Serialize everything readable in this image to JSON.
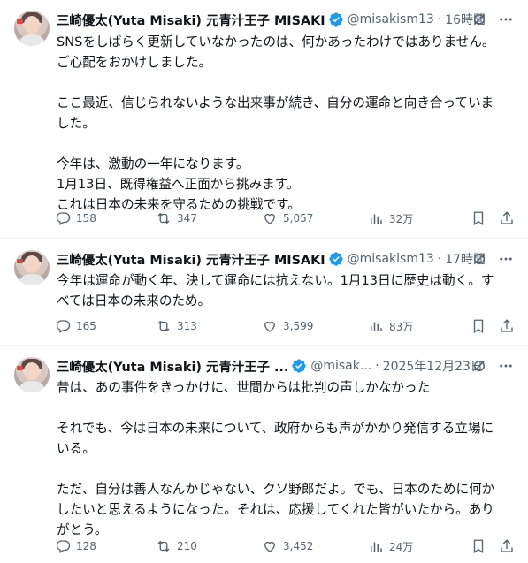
{
  "tweets": [
    {
      "author": "三崎優太(Yuta Misaki) 元青汁王子 MISAKI",
      "handle": "@misakism13",
      "time": "16時間",
      "lines": [
        "SNSをしばらく更新していなかったのは、何かあったわけではありません。",
        "ご心配をおかけしました。",
        "",
        "ここ最近、信じられないような出来事が続き、自分の運命と向き合っていま",
        "した。",
        "",
        "今年は、激動の一年になります。",
        "1月13日、既得権益へ正面から挑みます。",
        "これは日本の未来を守るための挑戦です。"
      ],
      "replies": "158",
      "reposts": "347",
      "likes": "5,057",
      "views": "32万"
    },
    {
      "author": "三崎優太(Yuta Misaki) 元青汁王子 MISAKI",
      "handle": "@misakism13",
      "time": "17時間",
      "lines": [
        "今年は運命が動く年、決して運命には抗えない。1月13日に歴史は動く。す",
        "べては日本の未来のため。"
      ],
      "replies": "165",
      "reposts": "313",
      "likes": "3,599",
      "views": "83万"
    },
    {
      "author": "三崎優太(Yuta Misaki) 元青汁王子 ...",
      "handle": "@misak...",
      "time": "2025年12月23日",
      "lines": [
        "昔は、あの事件をきっかけに、世間からは批判の声しかなかった",
        "",
        "それでも、今は日本の未来について、政府からも声がかかり発信する立場に",
        "いる。",
        "",
        "ただ、自分は善人なんかじゃない、クソ野郎だよ。でも、日本のために何か",
        "したいと思えるようになった。それは、応援してくれた皆がいたから。あり",
        "がとう。"
      ],
      "replies": "128",
      "reposts": "210",
      "likes": "3,452",
      "views": "24万"
    }
  ],
  "colors": {
    "text": "#0f1419",
    "secondary": "#536471",
    "verified": "#1d9bf0",
    "divider": "#eff3f4"
  },
  "icons": {
    "verified": "verified-badge-icon",
    "grok": "grok-icon",
    "more": "more-icon",
    "reply": "reply-icon",
    "repost": "repost-icon",
    "like": "like-icon",
    "views": "views-icon",
    "bookmark": "bookmark-icon",
    "share": "share-icon"
  }
}
